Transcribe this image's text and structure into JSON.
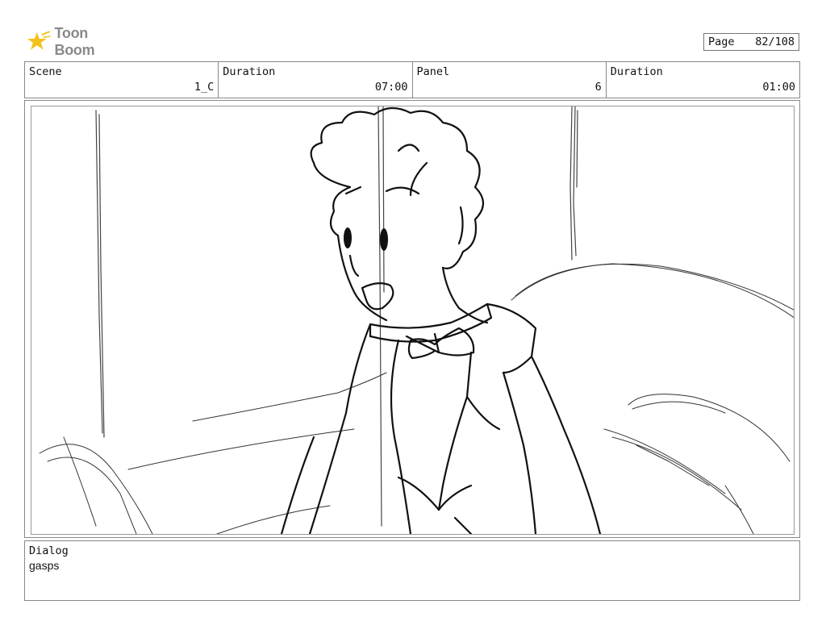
{
  "header": {
    "logo_text": "Toon Boom",
    "page_label": "Page",
    "page_value": "82/108"
  },
  "info": [
    {
      "label": "Scene",
      "value": "1_C"
    },
    {
      "label": "Duration",
      "value": "07:00"
    },
    {
      "label": "Panel",
      "value": "6"
    },
    {
      "label": "Duration",
      "value": "01:00"
    }
  ],
  "dialog": {
    "label": "Dialog",
    "text": "gasps"
  },
  "colors": {
    "logo_star": "#f2c21b",
    "logo_text": "#8a8a8a",
    "border": "#888888"
  }
}
